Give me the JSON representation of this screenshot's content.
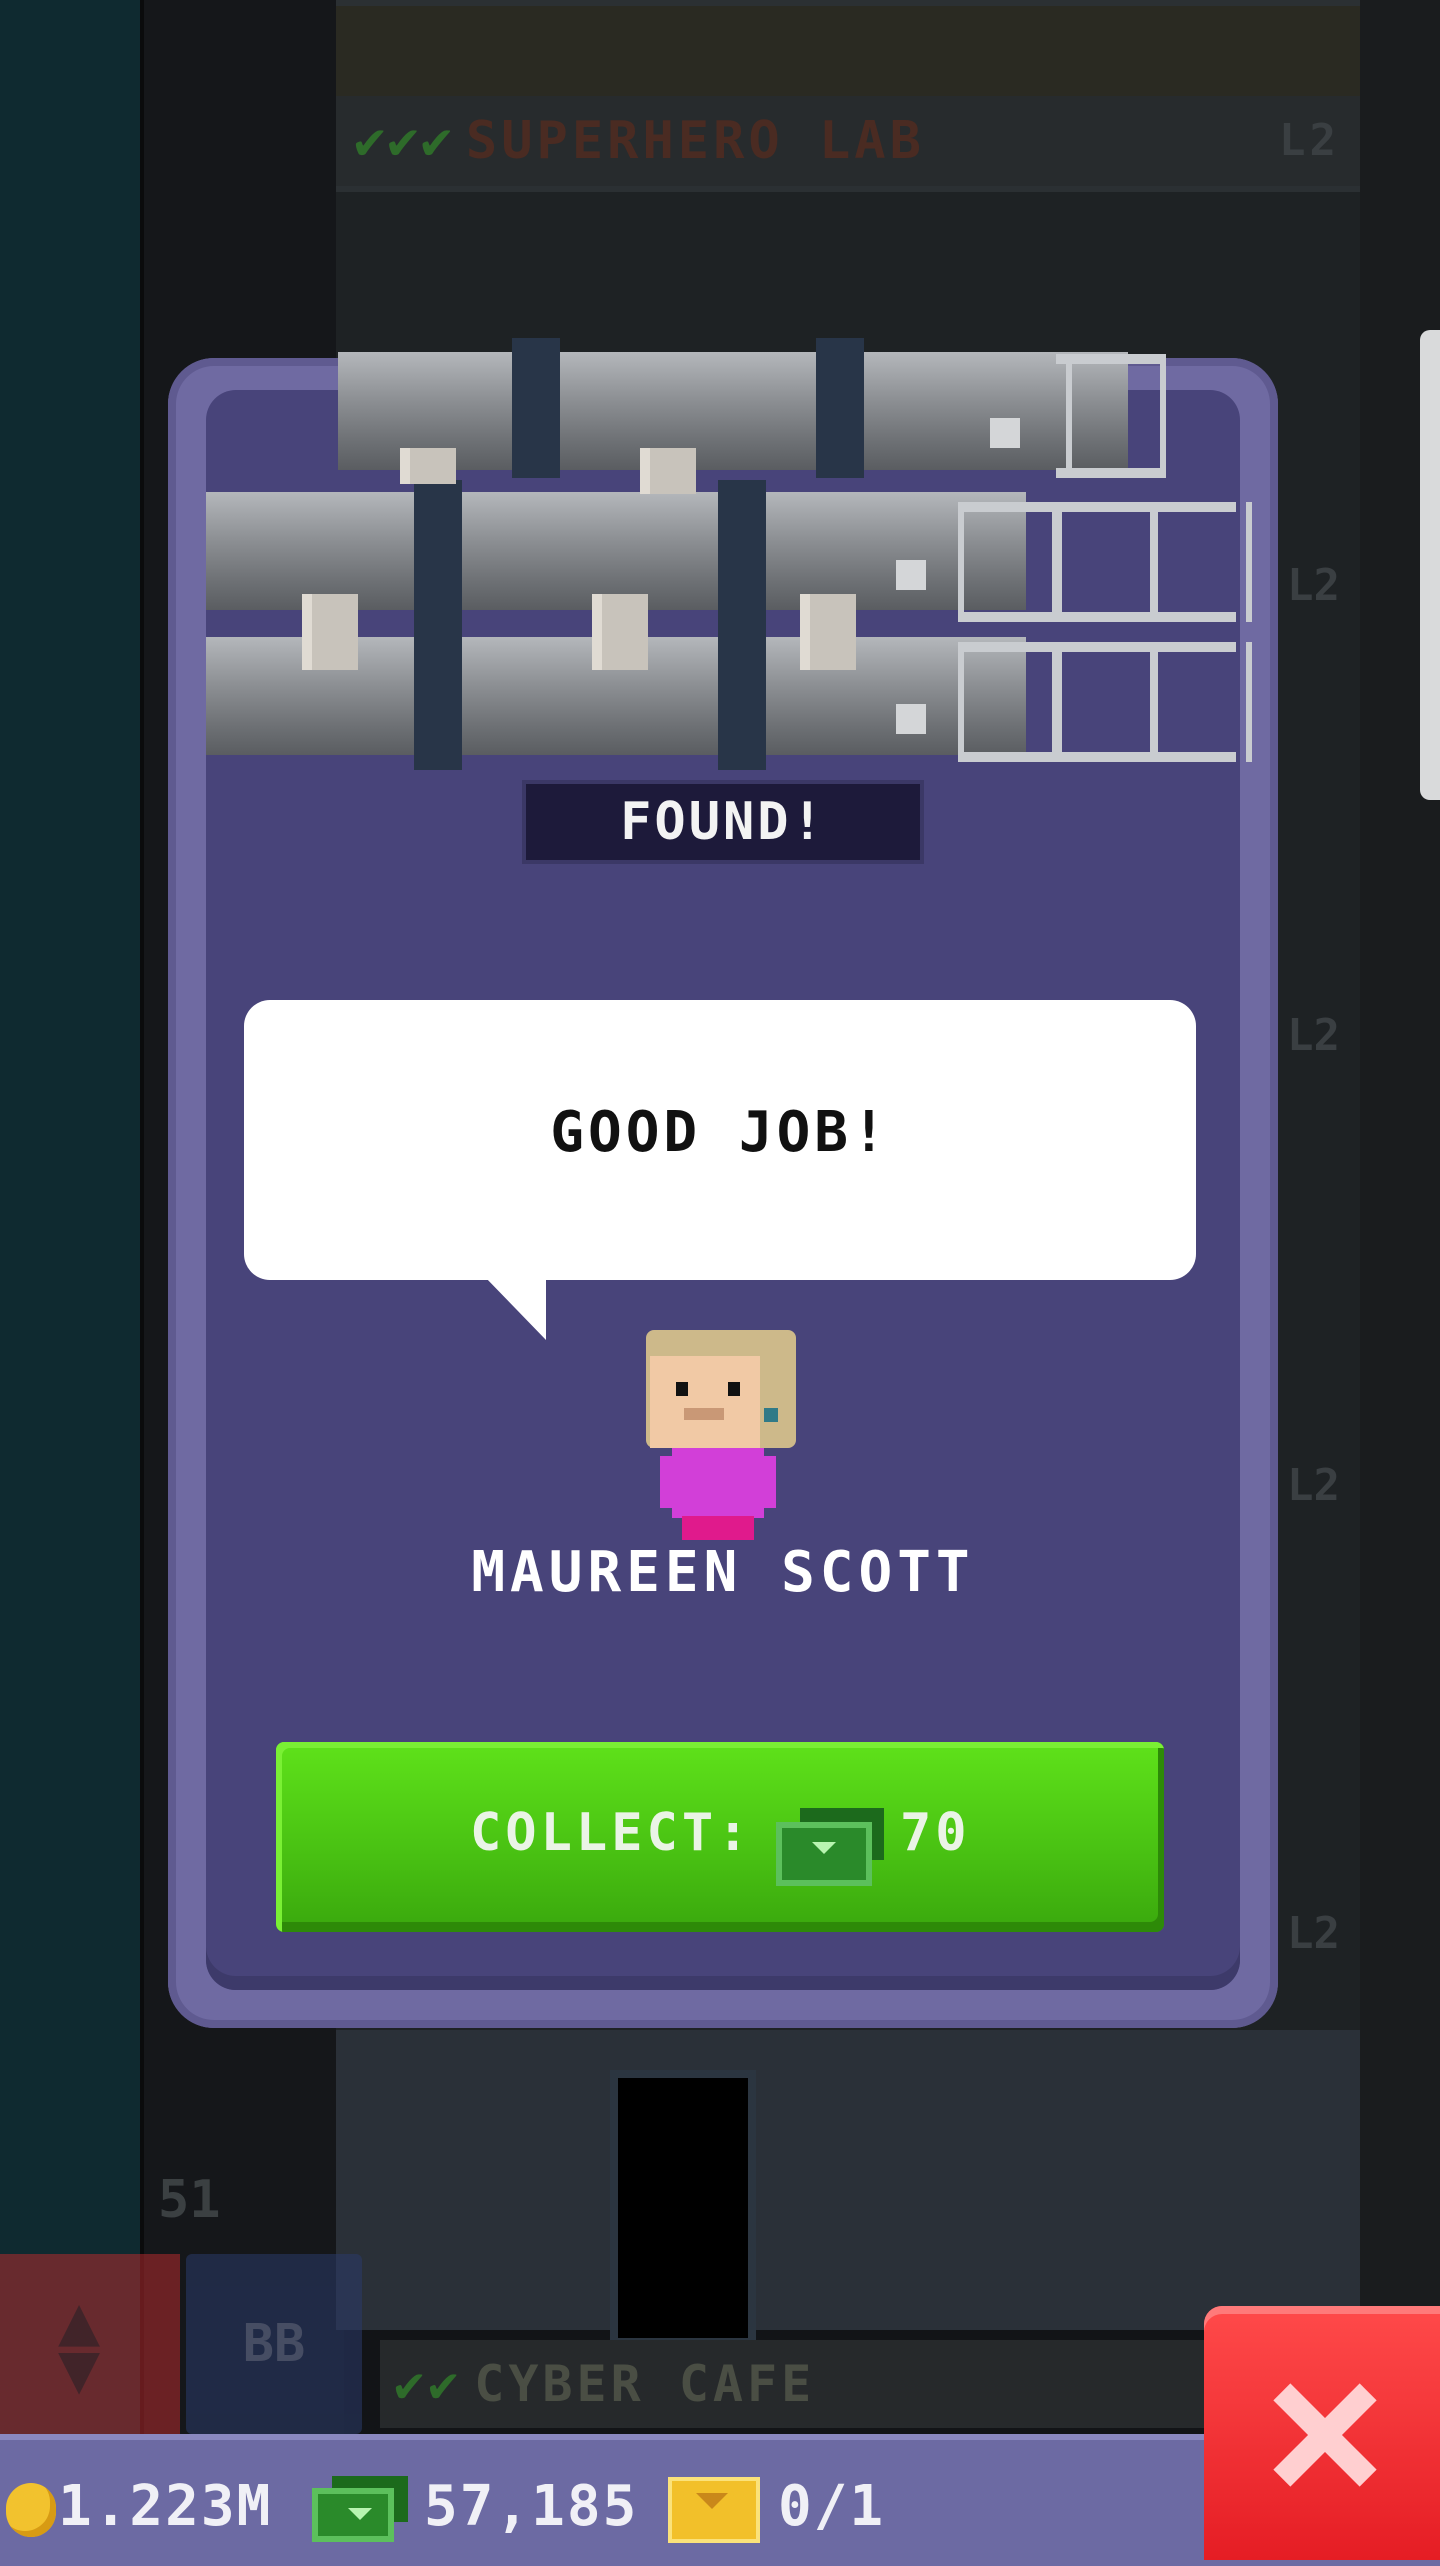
{
  "background": {
    "top_floor_name": "SUPERHERO LAB",
    "top_floor_level": "L2",
    "side_levels": [
      "L2",
      "L2",
      "L2",
      "L2",
      "L2"
    ],
    "floor_number": "51",
    "bottom_floor_name": "CYBER CAFE",
    "bb_button": "BB"
  },
  "modal": {
    "status": "FOUND!",
    "speech": "GOOD JOB!",
    "character_name": "MAUREEN SCOTT",
    "collect_label": "COLLECT:",
    "collect_amount": "70",
    "button_color": "#4ac313",
    "panel_color": "#48447a"
  },
  "hud": {
    "coins": "1.223M",
    "bux": "57,185",
    "tickets": "0/1"
  },
  "icons": {
    "coin": "coin-icon",
    "bux": "bux-icon",
    "ticket": "ticket-icon",
    "close": "close-icon",
    "elevator": "elevator-arrows-icon",
    "check": "check-icon"
  }
}
